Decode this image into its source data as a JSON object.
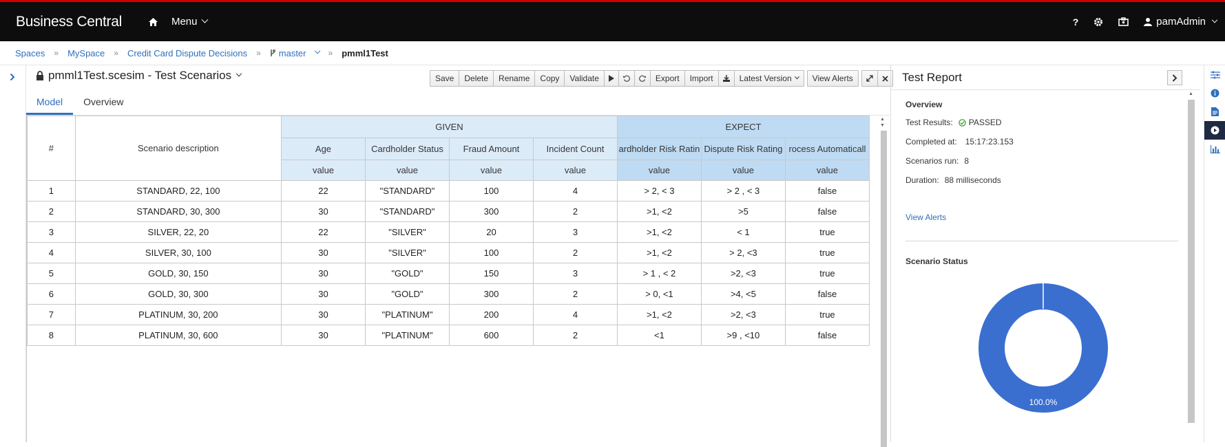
{
  "topbar": {
    "brand": "Business Central",
    "menu_label": "Menu",
    "help_label": "?",
    "user": "pamAdmin"
  },
  "breadcrumb": {
    "items": [
      "Spaces",
      "MySpace",
      "Credit Card Dispute Decisions"
    ],
    "branch": "master",
    "current": "pmml1Test"
  },
  "editor": {
    "title": "pmml1Test.scesim - Test Scenarios",
    "toolbar": {
      "group1": [
        "Save",
        "Delete",
        "Rename",
        "Copy",
        "Validate"
      ],
      "group2": [
        "Export",
        "Import"
      ],
      "latest_version": "Latest Version",
      "view_alerts": "View Alerts"
    },
    "tabs": [
      "Model",
      "Overview"
    ]
  },
  "grid": {
    "idx_header": "#",
    "desc_header": "Scenario description",
    "given_label": "GIVEN",
    "expect_label": "EXPECT",
    "columns": [
      {
        "name": "Age",
        "sub": "value",
        "group": "given"
      },
      {
        "name": "Cardholder Status",
        "sub": "value",
        "group": "given"
      },
      {
        "name": "Fraud Amount",
        "sub": "value",
        "group": "given"
      },
      {
        "name": "Incident Count",
        "sub": "value",
        "group": "given"
      },
      {
        "name": "ardholder Risk Ratin",
        "sub": "value",
        "group": "expect"
      },
      {
        "name": "Dispute Risk Rating",
        "sub": "value",
        "group": "expect"
      },
      {
        "name": "rocess Automaticall",
        "sub": "value",
        "group": "expect"
      }
    ],
    "rows": [
      [
        "1",
        "STANDARD, 22, 100",
        "22",
        "\"STANDARD\"",
        "100",
        "4",
        "> 2, < 3",
        "> 2 , < 3",
        "false"
      ],
      [
        "2",
        "STANDARD, 30, 300",
        "30",
        "\"STANDARD\"",
        "300",
        "2",
        ">1, <2",
        ">5",
        "false"
      ],
      [
        "3",
        "SILVER, 22, 20",
        "22",
        "\"SILVER\"",
        "20",
        "3",
        ">1, <2",
        "< 1",
        "true"
      ],
      [
        "4",
        "SILVER, 30, 100",
        "30",
        "\"SILVER\"",
        "100",
        "2",
        ">1, <2",
        "> 2, <3",
        "true"
      ],
      [
        "5",
        "GOLD, 30, 150",
        "30",
        "\"GOLD\"",
        "150",
        "3",
        "> 1 , < 2",
        ">2, <3",
        "true"
      ],
      [
        "6",
        "GOLD, 30, 300",
        "30",
        "\"GOLD\"",
        "300",
        "2",
        "> 0, <1",
        ">4, <5",
        "false"
      ],
      [
        "7",
        "PLATINUM, 30, 200",
        "30",
        "\"PLATINUM\"",
        "200",
        "4",
        ">1, <2",
        ">2, <3",
        "true"
      ],
      [
        "8",
        "PLATINUM, 30, 600",
        "30",
        "\"PLATINUM\"",
        "600",
        "2",
        "<1",
        ">9 , <10",
        "false"
      ]
    ]
  },
  "report": {
    "title": "Test Report",
    "overview_label": "Overview",
    "test_results_label": "Test Results:",
    "test_results_value": "PASSED",
    "completed_label": "Completed at:",
    "completed_value": "15:17:23.153",
    "scenarios_label": "Scenarios run:",
    "scenarios_value": "8",
    "duration_label": "Duration:",
    "duration_value": "88 milliseconds",
    "view_alerts": "View Alerts",
    "status_title": "Scenario Status",
    "donut_label": "100.0%",
    "passed_fraction": 1.0,
    "donut_color": "#3a6fd0"
  },
  "colors": {
    "accent": "#2f6fbd",
    "topbar": "#0d0d0d",
    "topbar_stripe": "#cc0000",
    "given_header": "#dcebf8",
    "expect_header": "#bfdbf3",
    "passed_icon": "#3f9c35"
  }
}
